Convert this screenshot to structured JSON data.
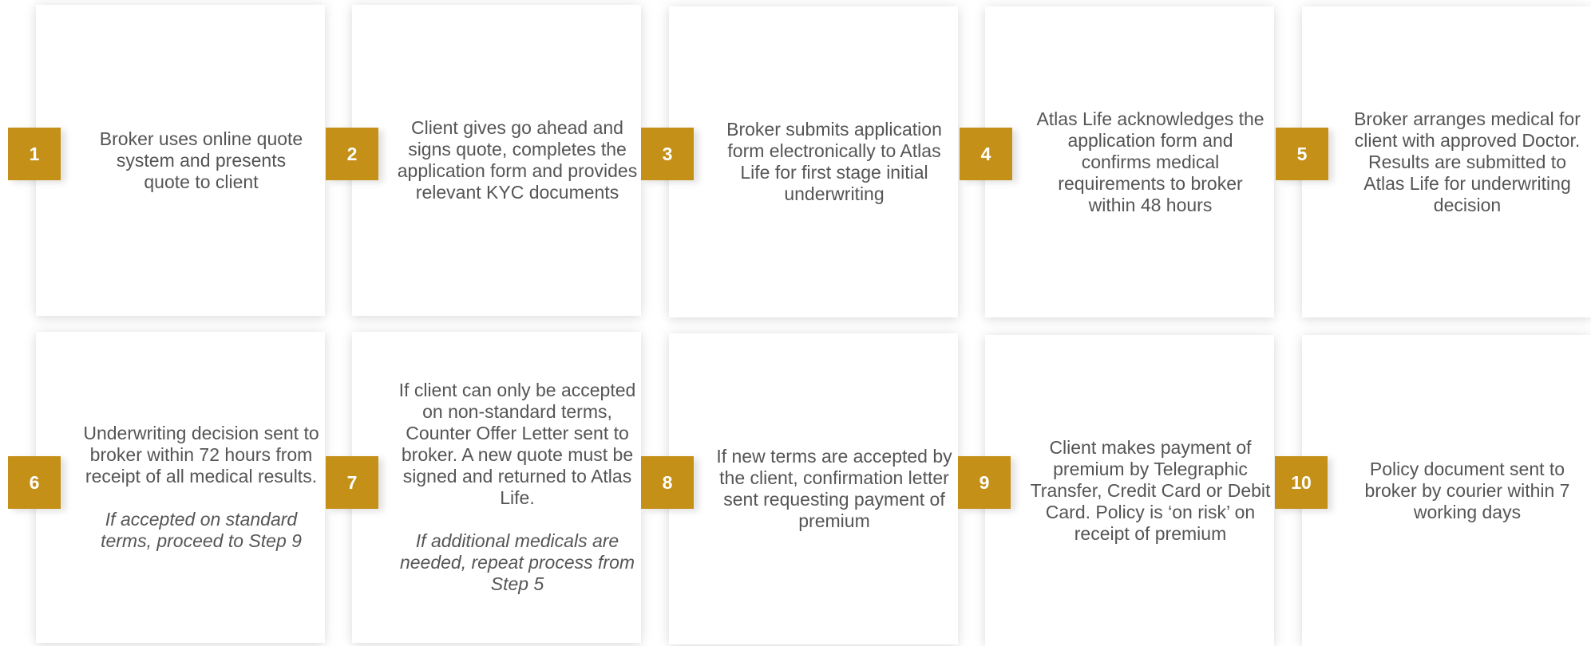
{
  "colors": {
    "accent": "#c49018",
    "text": "#555555",
    "card": "#ffffff"
  },
  "steps": [
    {
      "number": "1",
      "text": "Broker uses online quote system and presents quote to client",
      "note": ""
    },
    {
      "number": "2",
      "text": "Client gives go ahead and signs quote, completes the application form and provides relevant KYC documents",
      "note": ""
    },
    {
      "number": "3",
      "text": "Broker submits application form electronically to Atlas Life for first stage initial underwriting",
      "note": ""
    },
    {
      "number": "4",
      "text": "Atlas Life acknowledges the application form and confirms medical requirements to broker within 48 hours",
      "note": ""
    },
    {
      "number": "5",
      "text": "Broker arranges medical for client with approved Doctor. Results are submitted to Atlas Life for underwriting decision",
      "note": ""
    },
    {
      "number": "6",
      "text": "Underwriting decision sent to broker within 72 hours from receipt of all medical results.",
      "note": "If accepted on standard terms, proceed to Step 9"
    },
    {
      "number": "7",
      "text": "If client can only be accepted on non-standard terms, Counter Offer Letter sent to broker. A new quote must be signed and returned to Atlas Life.",
      "note": "If additional medicals are needed, repeat process from Step 5"
    },
    {
      "number": "8",
      "text": "If new terms are accepted by the client, confirmation letter sent requesting payment of premium",
      "note": ""
    },
    {
      "number": "9",
      "text": "Client makes payment of premium by Telegraphic Transfer, Credit Card or Debit Card. Policy is ‘on risk’ on receipt of premium",
      "note": ""
    },
    {
      "number": "10",
      "text": "Policy document sent to broker by courier within 7 working days",
      "note": ""
    }
  ]
}
